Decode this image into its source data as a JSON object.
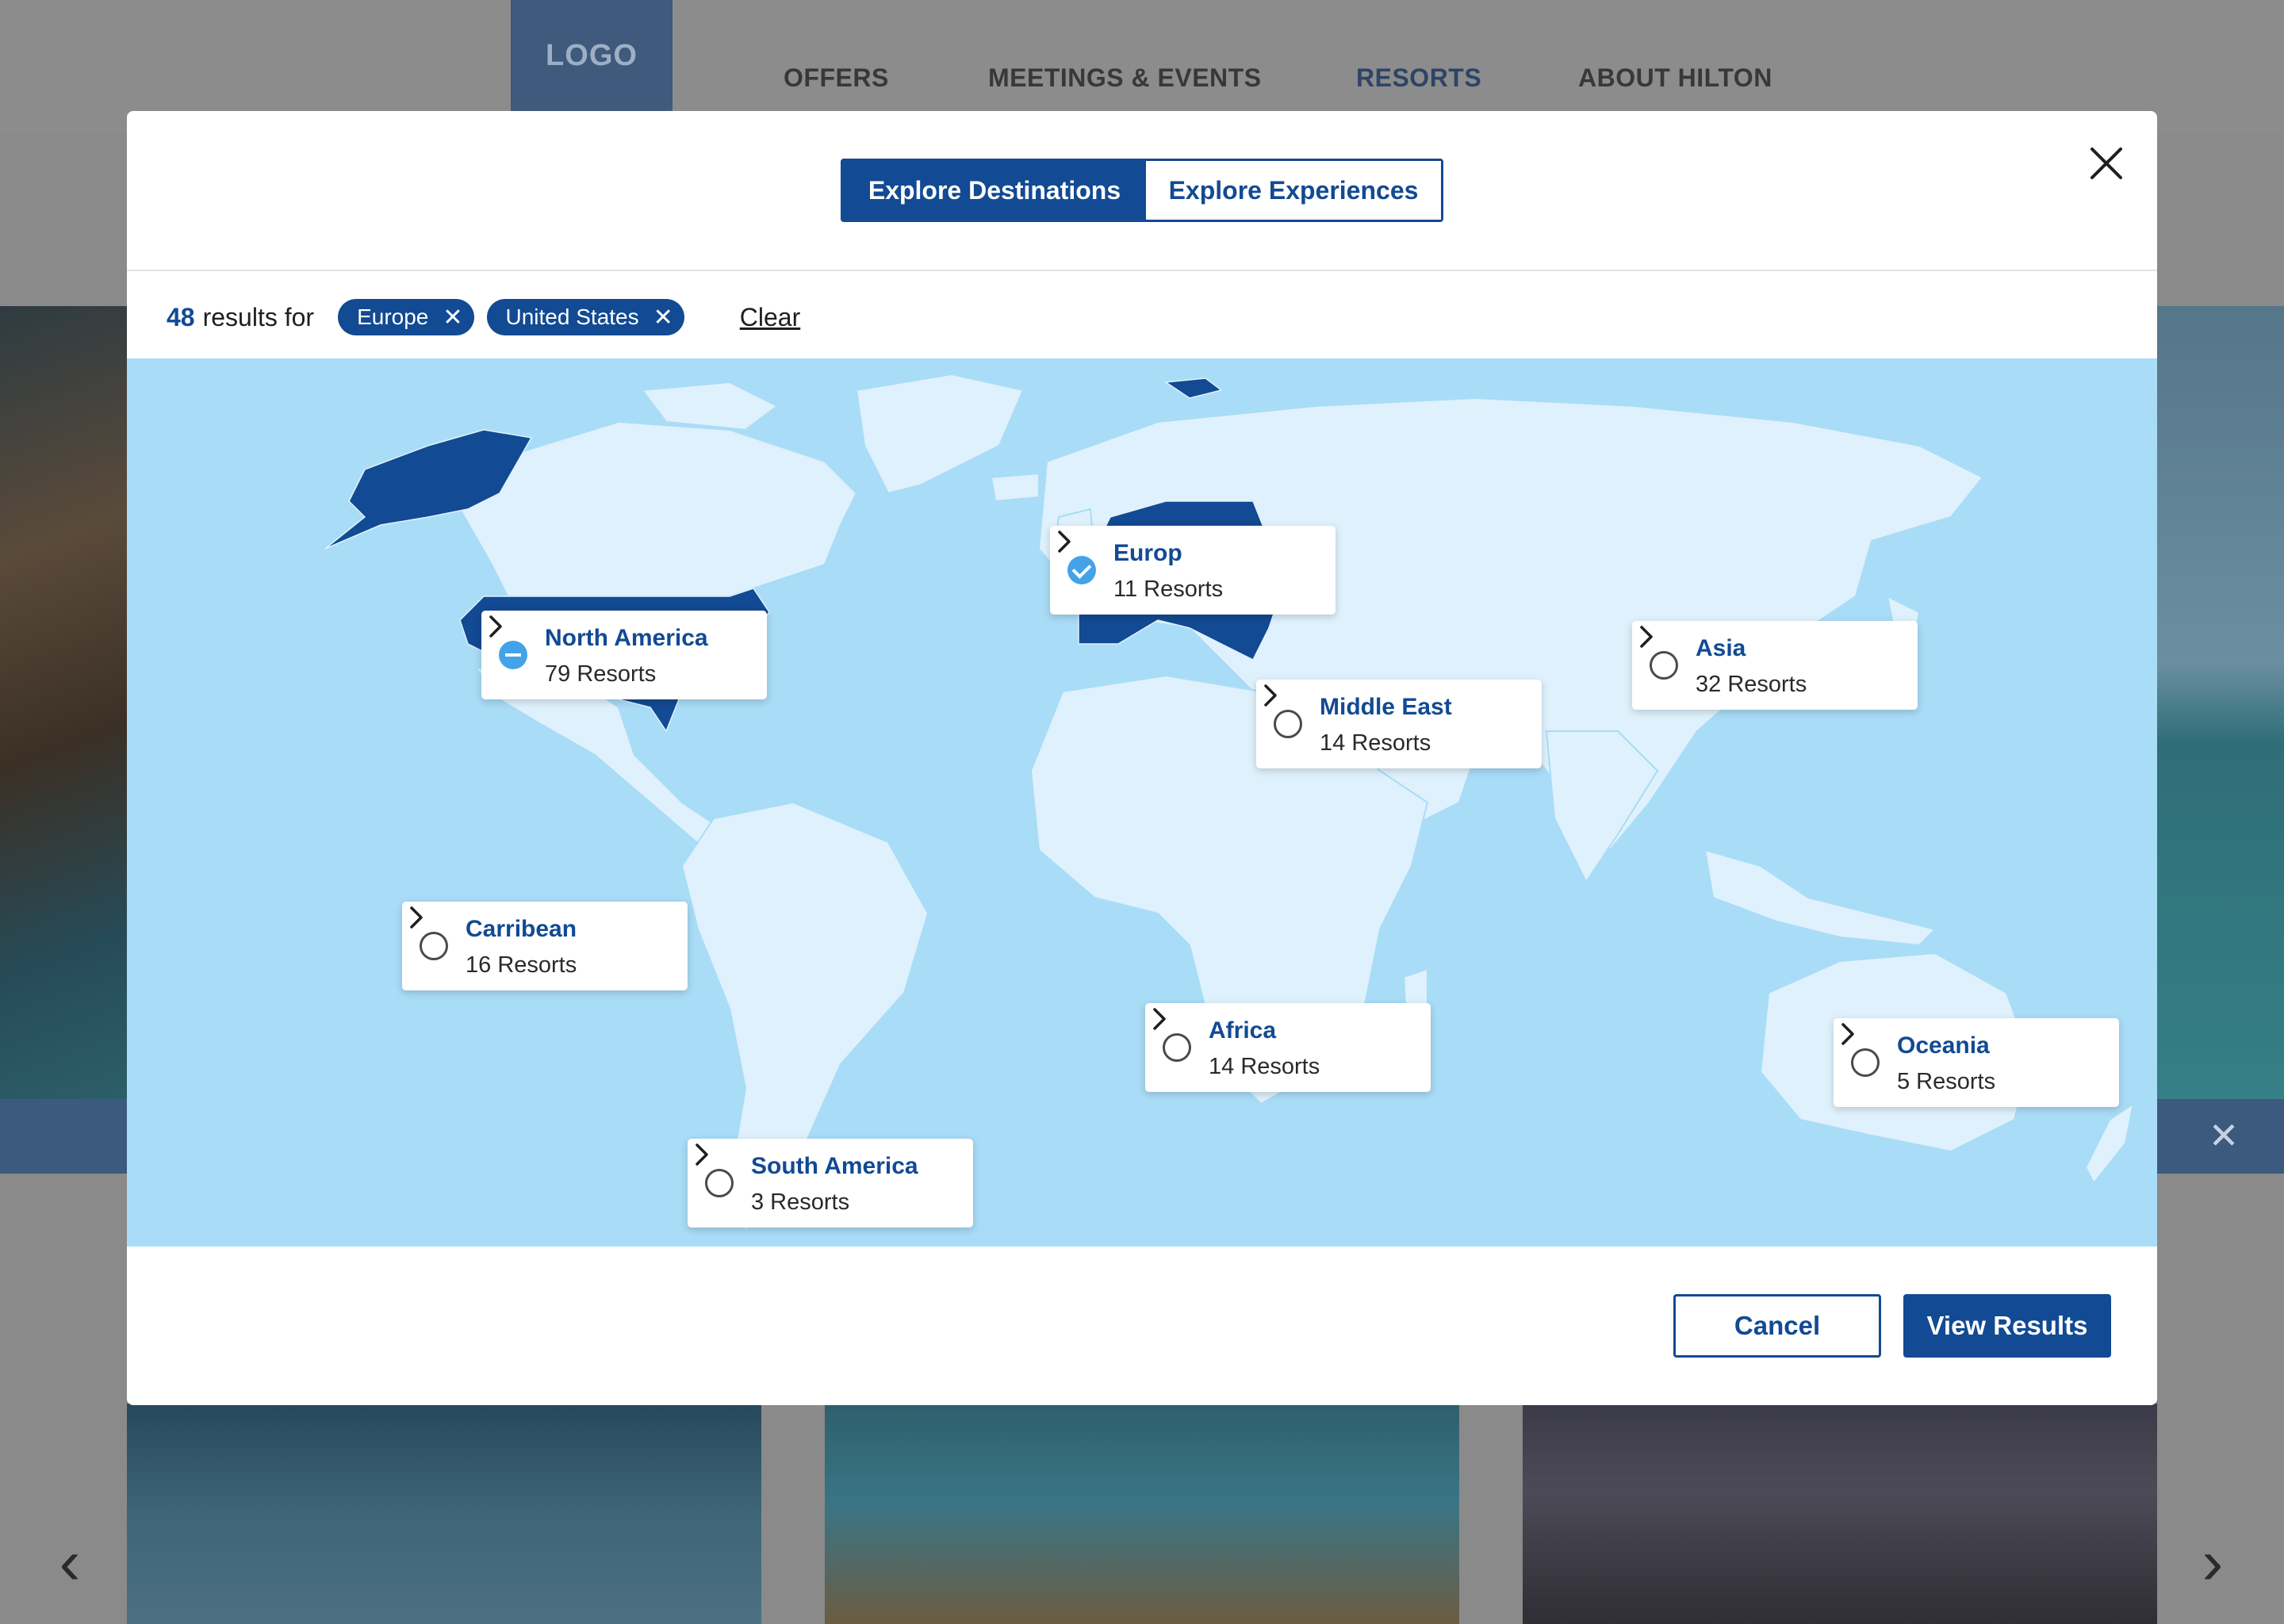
{
  "site": {
    "logo": "LOGO",
    "nav": [
      "OFFERS",
      "MEETINGS & EVENTS",
      "RESORTS",
      "ABOUT HILTON"
    ],
    "active_nav": "RESORTS"
  },
  "modal": {
    "tabs": [
      {
        "label": "Explore Destinations",
        "active": true
      },
      {
        "label": "Explore Experiences",
        "active": false
      }
    ],
    "filter": {
      "count": "48",
      "results_for": "results for",
      "chips": [
        "Europe",
        "United States"
      ],
      "clear_label": "Clear"
    },
    "regions": [
      {
        "name": "Europ",
        "count": "11 Resorts",
        "state": "checked"
      },
      {
        "name": "North America",
        "count": "79 Resorts",
        "state": "partial"
      },
      {
        "name": "Asia",
        "count": "32 Resorts",
        "state": "unchecked"
      },
      {
        "name": "Middle East",
        "count": "14 Resorts",
        "state": "unchecked"
      },
      {
        "name": "Carribean",
        "count": "16 Resorts",
        "state": "unchecked"
      },
      {
        "name": "Africa",
        "count": "14 Resorts",
        "state": "unchecked"
      },
      {
        "name": "Oceania",
        "count": "5 Resorts",
        "state": "unchecked"
      },
      {
        "name": "South America",
        "count": "3 Resorts",
        "state": "unchecked"
      }
    ],
    "cancel_label": "Cancel",
    "view_results_label": "View Results"
  },
  "colors": {
    "brand": "#124a93",
    "map_water": "#a9dcf7",
    "map_land": "#dff1fc",
    "selected_land": "#124a93",
    "check_blue": "#43a3e8"
  }
}
